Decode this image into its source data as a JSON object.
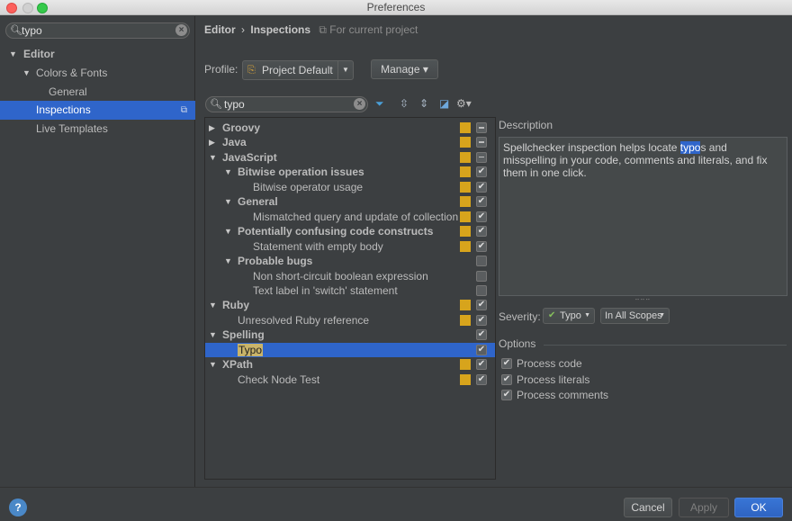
{
  "window": {
    "title": "Preferences"
  },
  "sidebar": {
    "search_value": "typo",
    "items": [
      {
        "label": "Editor",
        "arrow": "▼",
        "bold": true
      },
      {
        "label": "Colors & Fonts",
        "arrow": "▼"
      },
      {
        "label": "General"
      },
      {
        "label": "Inspections",
        "selected": true
      },
      {
        "label": "Live Templates"
      }
    ]
  },
  "breadcrumb": {
    "part1": "Editor",
    "separator": "›",
    "part2": "Inspections",
    "scope": "For current project"
  },
  "profile": {
    "label": "Profile:",
    "value": "Project Default",
    "manage_label": "Manage ▾"
  },
  "inspection_search": {
    "value": "typo"
  },
  "inspections": [
    {
      "label": "Groovy",
      "arrow": "▶",
      "bold": true,
      "severity": "warning",
      "checked": "mixed"
    },
    {
      "label": "Java",
      "arrow": "▶",
      "bold": true,
      "severity": "warning",
      "checked": "mixed"
    },
    {
      "label": "JavaScript",
      "arrow": "▼",
      "bold": true,
      "severity": "warning",
      "checked": "mixed"
    },
    {
      "label": "Bitwise operation issues",
      "arrow": "▼",
      "bold": true,
      "severity": "warning",
      "checked": "on"
    },
    {
      "label": "Bitwise operator usage",
      "severity": "warning",
      "checked": "on"
    },
    {
      "label": "General",
      "arrow": "▼",
      "bold": true,
      "severity": "warning",
      "checked": "on"
    },
    {
      "label": "Mismatched query and update of collection",
      "severity": "warning",
      "checked": "on"
    },
    {
      "label": "Potentially confusing code constructs",
      "arrow": "▼",
      "bold": true,
      "severity": "warning",
      "checked": "on"
    },
    {
      "label": "Statement with empty body",
      "severity": "warning",
      "checked": "on"
    },
    {
      "label": "Probable bugs",
      "arrow": "▼",
      "bold": true,
      "checked": "off"
    },
    {
      "label": "Non short-circuit boolean expression",
      "checked": "off"
    },
    {
      "label": "Text label in 'switch' statement",
      "checked": "off"
    },
    {
      "label": "Ruby",
      "arrow": "▼",
      "bold": true,
      "severity": "warning",
      "checked": "on"
    },
    {
      "label": "Unresolved Ruby reference",
      "severity": "warning",
      "checked": "on"
    },
    {
      "label": "Spelling",
      "arrow": "▼",
      "bold": true,
      "checked": "on"
    },
    {
      "label": "Typo",
      "checked": "on",
      "selected": true
    },
    {
      "label": "XPath",
      "arrow": "▼",
      "bold": true,
      "severity": "warning",
      "checked": "on"
    },
    {
      "label": "Check Node Test",
      "severity": "warning",
      "checked": "on"
    }
  ],
  "description": {
    "label": "Description",
    "before": "Spellchecker inspection helps locate ",
    "highlight": "typo",
    "after": "s and misspelling in your code, comments and literals, and fix them in one click."
  },
  "severity": {
    "label": "Severity:",
    "value": "Typo",
    "scope": "In All Scopes"
  },
  "options": {
    "label": "Options",
    "items": [
      {
        "label": "Process code",
        "checked": true
      },
      {
        "label": "Process literals",
        "checked": true
      },
      {
        "label": "Process comments",
        "checked": true
      }
    ]
  },
  "footer": {
    "help": "?",
    "cancel": "Cancel",
    "apply": "Apply",
    "ok": "OK"
  },
  "colors": {
    "accent": "#2f65ca",
    "warning": "#d7a41c",
    "background": "#3c3f41"
  }
}
